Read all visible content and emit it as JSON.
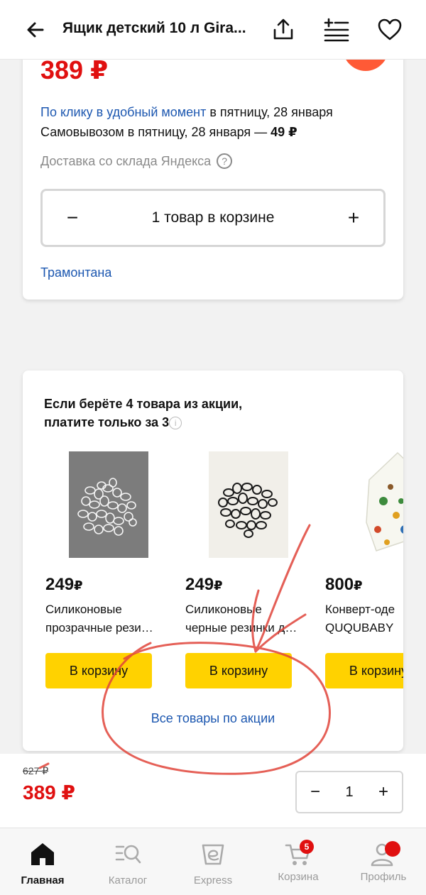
{
  "header": {
    "title": "Ящик детский 10 л Gira..."
  },
  "offer": {
    "price": "389 ₽",
    "delivery_link": "По клику в удобный момент",
    "delivery_date": " в пятницу, 28 января",
    "pickup_text": "Самовывозом в пятницу, 28 января — ",
    "pickup_price": "49 ₽",
    "warehouse": "Доставка со склада Яндекса",
    "help_glyph": "?",
    "cart_minus": "−",
    "cart_text": "1 товар в корзине",
    "cart_plus": "+",
    "seller": "Трамонтана"
  },
  "promo": {
    "title": "Если берёте 4 товара из акции, платите только за 3",
    "info_glyph": "i",
    "all_link": "Все товары по акции",
    "products": [
      {
        "price": "249",
        "currency": "₽",
        "name_line1": "Силиконовые",
        "name_line2": "прозрачные рези…",
        "button": "В корзину"
      },
      {
        "price": "249",
        "currency": "₽",
        "name_line1": "Силиконовые",
        "name_line2": "черные резинки д…",
        "button": "В корзину"
      },
      {
        "price": "800",
        "currency": "₽",
        "name_line1": "Конверт-оде",
        "name_line2": "QUQUBABY",
        "button": "В корзину"
      }
    ]
  },
  "sticky": {
    "old_price": "627 ₽",
    "new_price": "389 ₽",
    "qty_minus": "−",
    "qty_value": "1",
    "qty_plus": "+"
  },
  "tabbar": {
    "tabs": [
      {
        "label": "Главная",
        "icon": "home-icon",
        "active": true
      },
      {
        "label": "Каталог",
        "icon": "catalog-search-icon",
        "active": false
      },
      {
        "label": "Express",
        "icon": "express-icon",
        "active": false
      },
      {
        "label": "Корзина",
        "icon": "cart-icon",
        "active": false,
        "badge": "5"
      },
      {
        "label": "Профиль",
        "icon": "profile-icon",
        "active": false
      }
    ]
  },
  "colors": {
    "price_red": "#e01010",
    "link_blue": "#1c57b0",
    "button_yellow": "#ffd200",
    "accent_orange": "#ff5a36",
    "annotation_red": "#e0443a"
  }
}
